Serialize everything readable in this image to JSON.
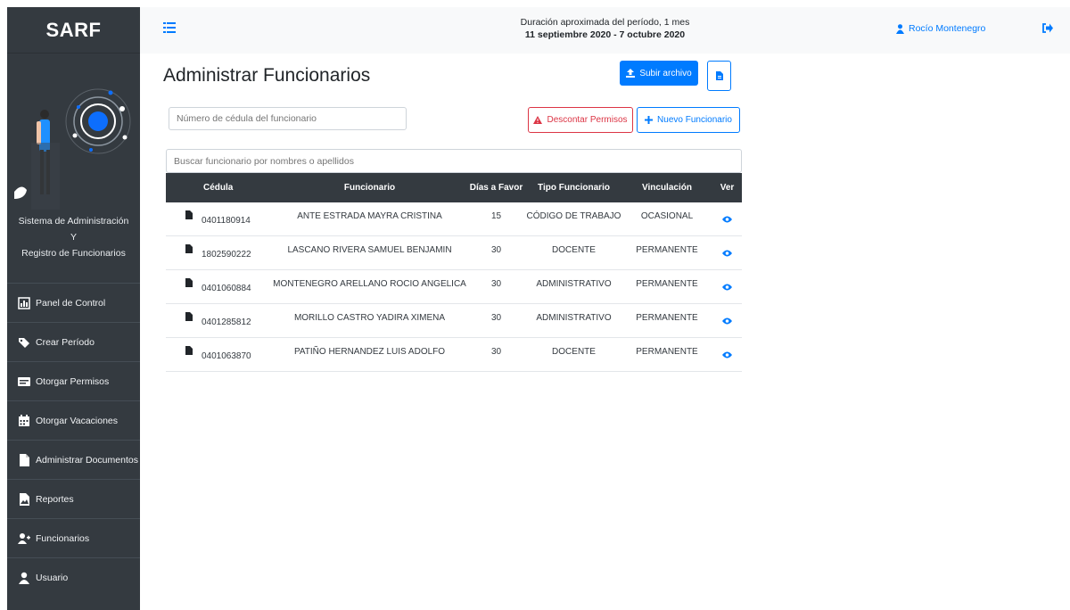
{
  "brand": "SARF",
  "system_title": {
    "line1": "Sistema de Administración",
    "line2": "Y",
    "line3": "Registro de Funcionarios"
  },
  "nav": [
    {
      "label": "Panel de Control",
      "icon": "chart-icon"
    },
    {
      "label": "Crear Período",
      "icon": "tags-icon"
    },
    {
      "label": "Otorgar Permisos",
      "icon": "id-card-icon"
    },
    {
      "label": "Otorgar Vacaciones",
      "icon": "calendar-icon"
    },
    {
      "label": "Administrar Documentos",
      "icon": "file-icon"
    },
    {
      "label": "Reportes",
      "icon": "file-image-icon"
    },
    {
      "label": "Funcionarios",
      "icon": "user-plus-icon"
    },
    {
      "label": "Usuario",
      "icon": "user-icon"
    }
  ],
  "topbar": {
    "period_line1": "Duración aproximada del período, 1 mes",
    "period_line2": "11 septiembre 2020 - 7 octubre 2020",
    "user_name": "Rocío Montenegro"
  },
  "main": {
    "title": "Administrar Funcionarios",
    "upload_label": "Subir archivo",
    "discount_label": "Descontar Permisos",
    "new_label": "Nuevo Funcionario",
    "cedula_placeholder": "Número de cédula del funcionario",
    "search_placeholder": "Buscar funcionario por nombres o apellidos"
  },
  "table": {
    "headers": [
      "Cédula",
      "Funcionario",
      "Días a Favor",
      "Tipo Funcionario",
      "Vinculación",
      "Ver"
    ],
    "rows": [
      [
        "0401180914",
        "ANTE ESTRADA MAYRA CRISTINA",
        "15",
        "CÓDIGO DE TRABAJO",
        "OCASIONAL"
      ],
      [
        "1802590222",
        "LASCANO RIVERA SAMUEL BENJAMIN",
        "30",
        "DOCENTE",
        "PERMANENTE"
      ],
      [
        "0401060884",
        "MONTENEGRO ARELLANO ROCIO ANGELICA",
        "30",
        "ADMINISTRATIVO",
        "PERMANENTE"
      ],
      [
        "0401285812",
        "MORILLO CASTRO YADIRA XIMENA",
        "30",
        "ADMINISTRATIVO",
        "PERMANENTE"
      ],
      [
        "0401063870",
        "PATIÑO HERNANDEZ LUIS ADOLFO",
        "30",
        "DOCENTE",
        "PERMANENTE"
      ]
    ]
  },
  "colors": {
    "sidebar": "#343a40",
    "primary": "#007bff",
    "danger": "#dc3545",
    "topbar": "#f8f9fa"
  }
}
